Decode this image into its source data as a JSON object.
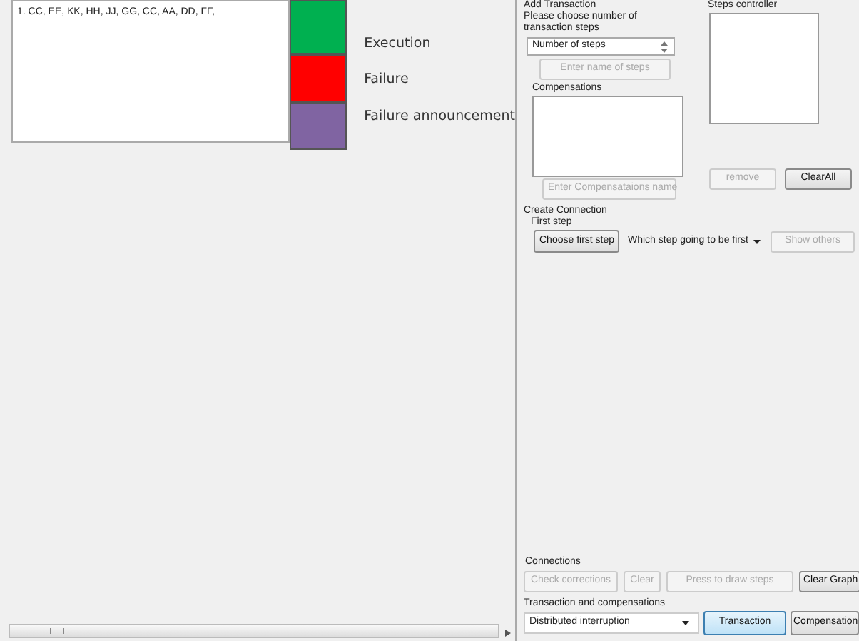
{
  "list_box": {
    "lines": [
      "1. CC, EE, KK, HH, JJ, GG, CC, AA, DD, FF,"
    ]
  },
  "legend": [
    {
      "label": "Execution",
      "color": "#00b050"
    },
    {
      "label": "Failure",
      "color": "#ff0000"
    },
    {
      "label": "Failure announcement",
      "color": "#8064a2"
    }
  ],
  "add_transaction": {
    "title": "Add Transaction",
    "prompt": "Please choose number of transaction steps",
    "steps_field": {
      "value": "Number of steps"
    },
    "names_button": {
      "label": "Enter name of steps",
      "disabled": true
    }
  },
  "steps_controller": {
    "title": "Steps controller",
    "buttons": [
      {
        "label": "remove",
        "disabled": true
      },
      {
        "label": "ClearAll",
        "disabled": false
      }
    ]
  },
  "compensations": {
    "title": "Compensations",
    "button": {
      "label": "Enter Compensataions name",
      "disabled": true
    }
  },
  "create_connection": {
    "title": "Create Connection",
    "subtitle": "First step",
    "choose_button": {
      "label": "Choose first step",
      "disabled": false
    },
    "first_step_select": {
      "value": "Which step going to be first"
    },
    "show_button": {
      "label": "Show others",
      "disabled": true
    }
  },
  "connections": {
    "title": "Connections",
    "buttons": [
      {
        "label": "Check corrections",
        "disabled": true
      },
      {
        "label": "Clear",
        "disabled": true
      },
      {
        "label": "Press to draw steps",
        "disabled": true
      },
      {
        "label": "Clear Graph",
        "disabled": false
      }
    ]
  },
  "transaction_and_compensations": {
    "title": "Transaction and compensations",
    "select": {
      "value": "Distributed interruption"
    },
    "tabs": [
      {
        "label": "Transaction",
        "selected": true
      },
      {
        "label": "Compensation",
        "selected": false
      }
    ]
  }
}
